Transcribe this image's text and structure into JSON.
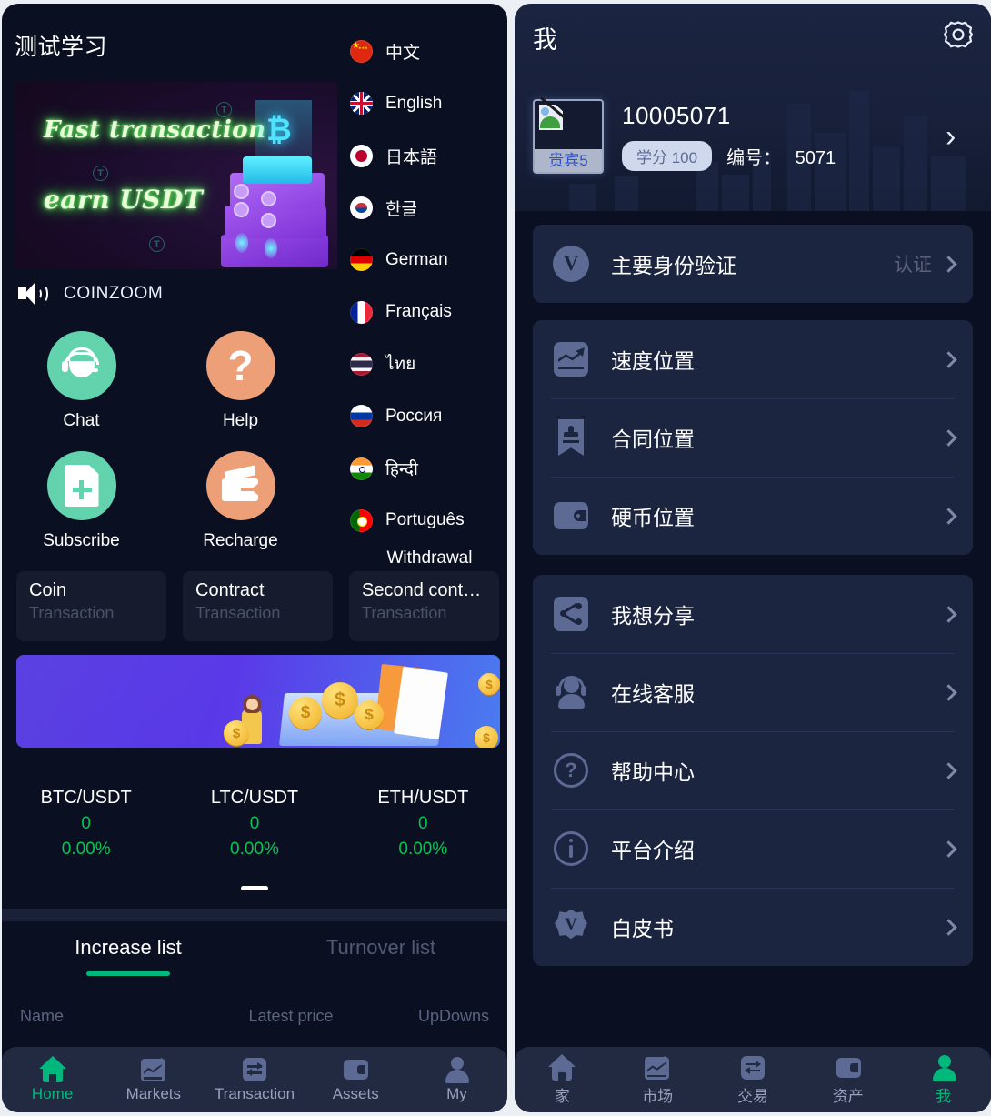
{
  "left": {
    "title": "测试学习",
    "hero": {
      "line1": "Fast transaction",
      "line2": "earn USDT",
      "token_mark": "T"
    },
    "notice": {
      "icon": "speaker-icon",
      "text": "COINZOOM"
    },
    "actions": [
      {
        "label": "Chat",
        "icon": "headset-icon",
        "color": "#63d3ad"
      },
      {
        "label": "Help",
        "icon": "question-mark-icon",
        "color": "#eda077"
      },
      {
        "label": "Subscribe",
        "icon": "document-plus-icon",
        "color": "#63d3ad"
      },
      {
        "label": "Recharge",
        "icon": "wallet-arrow-icon",
        "color": "#eda077"
      }
    ],
    "withdrawal_label": "Withdrawal",
    "languages": [
      {
        "name": "中文",
        "flag": "flag-china-icon"
      },
      {
        "name": "English",
        "flag": "flag-uk-icon"
      },
      {
        "name": "日本語",
        "flag": "flag-japan-icon"
      },
      {
        "name": "한글",
        "flag": "flag-korea-icon"
      },
      {
        "name": "German",
        "flag": "flag-germany-icon"
      },
      {
        "name": "Français",
        "flag": "flag-france-icon"
      },
      {
        "name": "ไทย",
        "flag": "flag-thailand-icon"
      },
      {
        "name": "Россия",
        "flag": "flag-russia-icon"
      },
      {
        "name": "हिन्दी",
        "flag": "flag-india-icon"
      },
      {
        "name": "Português",
        "flag": "flag-portugal-icon"
      }
    ],
    "transaction_cards": [
      {
        "title": "Coin",
        "subtitle": "Transaction"
      },
      {
        "title": "Contract",
        "subtitle": "Transaction"
      },
      {
        "title": "Second cont…",
        "subtitle": "Transaction"
      }
    ],
    "tickers": [
      {
        "pair": "BTC/USDT",
        "value": "0",
        "change": "0.00%"
      },
      {
        "pair": "LTC/USDT",
        "value": "0",
        "change": "0.00%"
      },
      {
        "pair": "ETH/USDT",
        "value": "0",
        "change": "0.00%"
      }
    ],
    "list_tabs": [
      {
        "label": "Increase list",
        "active": true
      },
      {
        "label": "Turnover list",
        "active": false
      }
    ],
    "list_headers": {
      "name": "Name",
      "price": "Latest price",
      "updowns": "UpDowns"
    },
    "bottom_nav": [
      {
        "label": "Home",
        "icon": "home-icon",
        "active": true
      },
      {
        "label": "Markets",
        "icon": "chart-icon",
        "active": false
      },
      {
        "label": "Transaction",
        "icon": "swap-icon",
        "active": false
      },
      {
        "label": "Assets",
        "icon": "wallet-icon",
        "active": false
      },
      {
        "label": "My",
        "icon": "user-icon",
        "active": false
      }
    ]
  },
  "right": {
    "title": "我",
    "settings_icon": "gear-icon",
    "profile": {
      "avatar_alt": "贵宾5",
      "user_id": "10005071",
      "credit_badge": "学分 100",
      "number_label": "编号：",
      "number_value": "5071",
      "chevron": "›"
    },
    "menu_groups": [
      {
        "items": [
          {
            "label": "主要身份验证",
            "icon": "verify-badge-icon",
            "right_text": "认证"
          }
        ]
      },
      {
        "items": [
          {
            "label": "速度位置",
            "icon": "trend-chart-icon",
            "right_text": ""
          },
          {
            "label": "合同位置",
            "icon": "contract-stamp-icon",
            "right_text": ""
          },
          {
            "label": "硬币位置",
            "icon": "wallet-icon",
            "right_text": ""
          }
        ]
      },
      {
        "items": [
          {
            "label": "我想分享",
            "icon": "share-icon",
            "right_text": ""
          },
          {
            "label": "在线客服",
            "icon": "customer-service-icon",
            "right_text": ""
          },
          {
            "label": "帮助中心",
            "icon": "question-circle-icon",
            "right_text": ""
          },
          {
            "label": "平台介绍",
            "icon": "info-circle-icon",
            "right_text": ""
          },
          {
            "label": "白皮书",
            "icon": "whitepaper-badge-icon",
            "right_text": ""
          }
        ]
      }
    ],
    "bottom_nav": [
      {
        "label": "家",
        "icon": "home-icon",
        "active": false
      },
      {
        "label": "市场",
        "icon": "chart-icon",
        "active": false
      },
      {
        "label": "交易",
        "icon": "swap-icon",
        "active": false
      },
      {
        "label": "资产",
        "icon": "wallet-icon",
        "active": false
      },
      {
        "label": "我",
        "icon": "user-icon",
        "active": true
      }
    ]
  },
  "colors": {
    "panel_bg": "#0b0f22",
    "accent_green": "#00b87c",
    "price_green": "#00c853",
    "nav_bg": "#222a42",
    "card_bg": "#161c2e",
    "menu_bg": "#1c2540",
    "icon_slate": "#5c6a94"
  }
}
